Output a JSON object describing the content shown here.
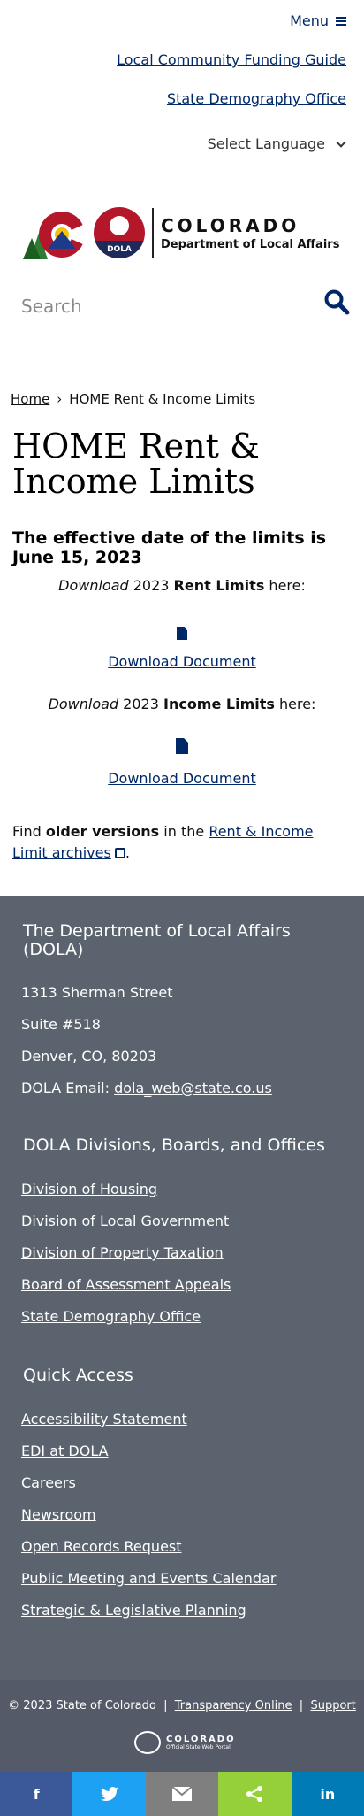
{
  "header": {
    "menu_label": "Menu",
    "links": [
      "Local Community Funding Guide",
      "State Demography Office"
    ],
    "language_label": "Select Language"
  },
  "logo": {
    "line1": "COLORADO",
    "line2": "Department of Local Affairs",
    "seal_text": "DOLA"
  },
  "search": {
    "placeholder": "Search"
  },
  "breadcrumb": {
    "home": "Home",
    "separator": "›",
    "current": "HOME Rent & Income Limits"
  },
  "page": {
    "title": "HOME Rent & Income Limits",
    "subheading": "The effective date of the limits is June 15, 2023",
    "rent": {
      "italic": "Download",
      "year": " 2023 ",
      "bold": "Rent Limits",
      "tail": " here:",
      "link": "Download Document"
    },
    "income": {
      "italic": "Download",
      "year": " 2023 ",
      "bold": "Income Limits",
      "tail": " here:",
      "link": " Download Document"
    },
    "older": {
      "pre": "Find ",
      "bold": "older versions",
      "mid": " in the ",
      "link": "Rent & Income Limit archives",
      "end": "."
    }
  },
  "footer": {
    "dept_heading": "The Department of Local Affairs (DOLA)",
    "address": [
      "1313 Sherman Street",
      "Suite  #518",
      "Denver, CO, 80203"
    ],
    "email_label": "DOLA Email: ",
    "email": "dola_web@state.co.us",
    "divisions_heading": "DOLA Divisions, Boards, and Offices",
    "divisions": [
      "Division of Housing",
      "Division of Local Government",
      "Division of Property Taxation",
      "Board of Assessment Appeals",
      "State Demography Office"
    ],
    "quick_heading": "Quick Access",
    "quick": [
      "Accessibility Statement",
      "EDI at DOLA",
      "Careers",
      "Newsroom",
      "Open Records Request",
      "Public Meeting and Events Calendar",
      "Strategic & Legislative Planning"
    ]
  },
  "bottom": {
    "copyright": "© 2023 State of Colorado",
    "sep": "|",
    "transparency": "Transparency Online",
    "support": "Support",
    "state_logo_line1": "COLORADO",
    "state_logo_line2": "Official State Web Portal"
  },
  "share": [
    {
      "icon": "facebook-icon",
      "glyph": "f",
      "color": "#3b5998"
    },
    {
      "icon": "twitter-icon",
      "glyph": "🐦",
      "color": "#1da1f2"
    },
    {
      "icon": "email-icon",
      "glyph": "✉",
      "color": "#7f7f7f"
    },
    {
      "icon": "share-icon",
      "glyph": "<",
      "color": "#95d03a"
    },
    {
      "icon": "linkedin-icon",
      "glyph": "in",
      "color": "#007bb5"
    }
  ],
  "colors": {
    "brand_blue": "#002868",
    "footer_bg": "#5b646e",
    "bottom_bg": "#545a68"
  }
}
